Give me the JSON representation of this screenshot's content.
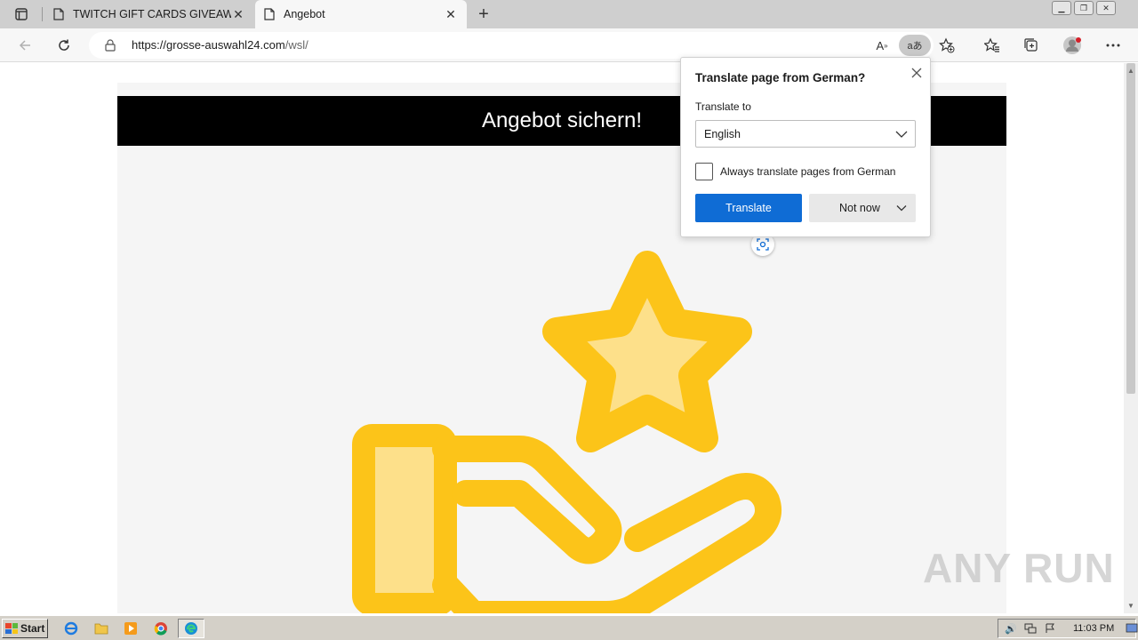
{
  "browser": {
    "tabs": [
      {
        "title": "TWITCH GIFT CARDS GIVEAWAY",
        "active": false
      },
      {
        "title": "Angebot",
        "active": true
      }
    ],
    "url_host": "https://grosse-auswahl24.com",
    "url_path": "/wsl/",
    "translate_pill_label": "aあ"
  },
  "page": {
    "header": "Angebot sichern!",
    "colors": {
      "star_outer": "#fcc419",
      "star_inner": "#fde08a",
      "header_bg": "#000000"
    }
  },
  "translate_popup": {
    "title": "Translate page from  German?",
    "translate_to_label": "Translate to",
    "language_selected": "English",
    "always_label": "Always translate pages from German",
    "always_checked": false,
    "translate_button": "Translate",
    "not_now_button": "Not now",
    "accent": "#0f6cd5"
  },
  "watermark": "ANY RUN",
  "taskbar": {
    "start_label": "Start",
    "clock": "11:03 PM"
  }
}
